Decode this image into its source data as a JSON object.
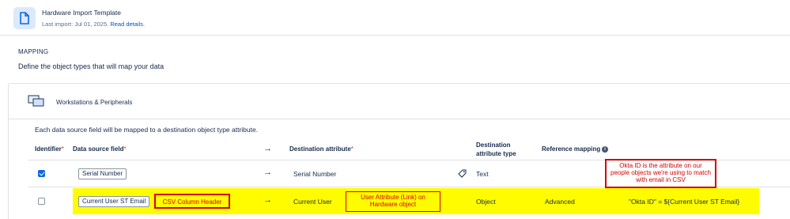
{
  "header": {
    "title": "Hardware Import Template",
    "last_import": "Last import: Jul 01, 2025.",
    "read_details": "Read details."
  },
  "mapping": {
    "title": "MAPPING",
    "description": "Define the object types that will map your data"
  },
  "panel": {
    "title": "Workstations & Peripherals",
    "hint": "Each data source field will be mapped to a destination object type attribute."
  },
  "columns": {
    "identifier": "Identifier",
    "data_source_field": "Data source field",
    "destination_attribute": "Destination attribute",
    "destination_attribute_type_line1": "Destination",
    "destination_attribute_type_line2": "attribute type",
    "reference_mapping": "Reference mapping",
    "required_mark": "*"
  },
  "rows": [
    {
      "identifier_checked": true,
      "source": "Serial Number",
      "arrow": "→",
      "destination": "Serial Number",
      "type": "Text",
      "reference": "",
      "reference_value": ""
    },
    {
      "identifier_checked": false,
      "source": "Current User ST Email",
      "arrow": "→",
      "destination": "Current User",
      "type": "Object",
      "reference": "Advanced",
      "reference_value": "\"Okta ID\" = ${Current User ST Email}"
    }
  ],
  "annotations": {
    "csv_header": "CSV Column Header",
    "user_attribute": "User Attribute (Link) on Hardware object",
    "okta_note": "Okta ID is the attribute on our people objects we're using to match with email in CSV"
  },
  "colors": {
    "highlight": "#fffc00",
    "annotation_red": "#d40000",
    "checkbox_blue": "#0c66e4",
    "link_blue": "#0052cc"
  }
}
